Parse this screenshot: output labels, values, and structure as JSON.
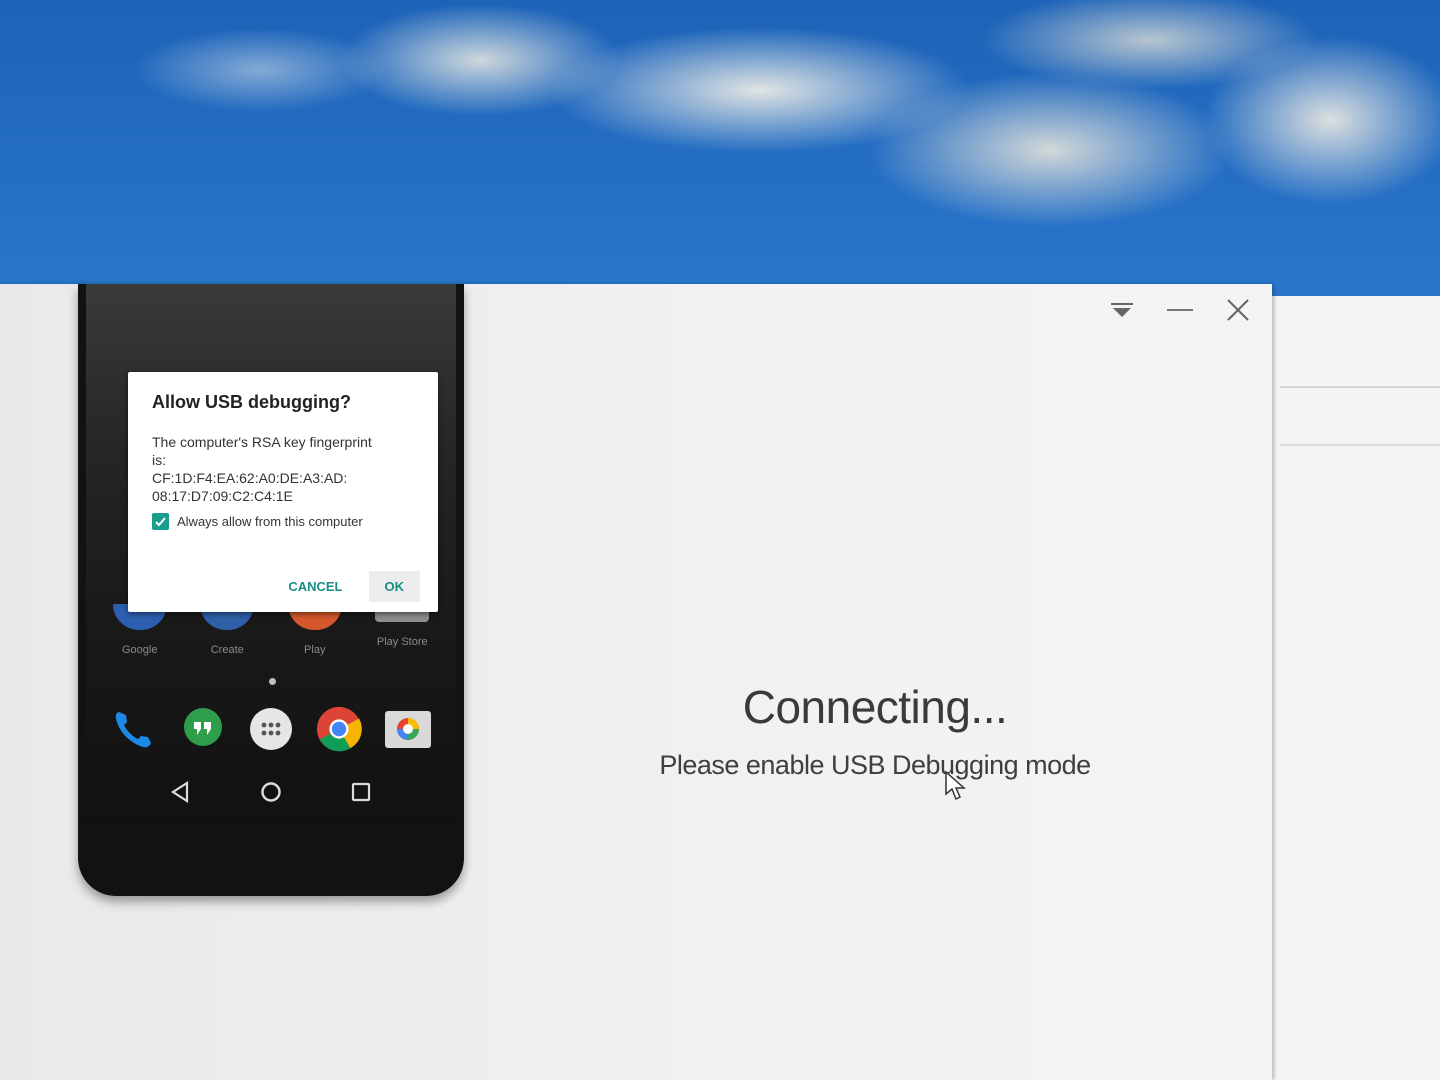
{
  "window": {
    "controls": [
      {
        "name": "dropdown-menu-icon",
        "label": ""
      },
      {
        "name": "minimize-icon",
        "label": ""
      },
      {
        "name": "close-icon",
        "label": ""
      }
    ]
  },
  "phone": {
    "apps": [
      {
        "label": "Google",
        "icon": "google-folder-icon",
        "color": "#2d5fb0"
      },
      {
        "label": "Create",
        "icon": "create-folder-icon",
        "color": "#2f5fa8"
      },
      {
        "label": "Play",
        "icon": "play-folder-icon",
        "color": "#d4582b"
      },
      {
        "label": "Play Store",
        "icon": "play-store-icon",
        "color": "#9a9a9a"
      }
    ],
    "dock": [
      {
        "name": "phone-icon"
      },
      {
        "name": "hangouts-icon"
      },
      {
        "name": "app-drawer-icon"
      },
      {
        "name": "chrome-icon"
      },
      {
        "name": "camera-icon"
      }
    ],
    "navbar": [
      {
        "name": "back-icon"
      },
      {
        "name": "home-icon"
      },
      {
        "name": "recents-icon"
      }
    ]
  },
  "dialog": {
    "title": "Allow USB debugging?",
    "message_line1": "The computer's RSA key fingerprint",
    "message_line2": "is:",
    "fingerprint_line1": "CF:1D:F4:EA:62:A0:DE:A3:AD:",
    "fingerprint_line2": "08:17:D7:09:C2:C4:1E",
    "checkbox_label": "Always allow from this computer",
    "checkbox_checked": true,
    "cancel_label": "CANCEL",
    "ok_label": "OK",
    "accent_color": "#1a8e84"
  },
  "status": {
    "title": "Connecting...",
    "subtitle": "Please enable USB Debugging mode"
  }
}
